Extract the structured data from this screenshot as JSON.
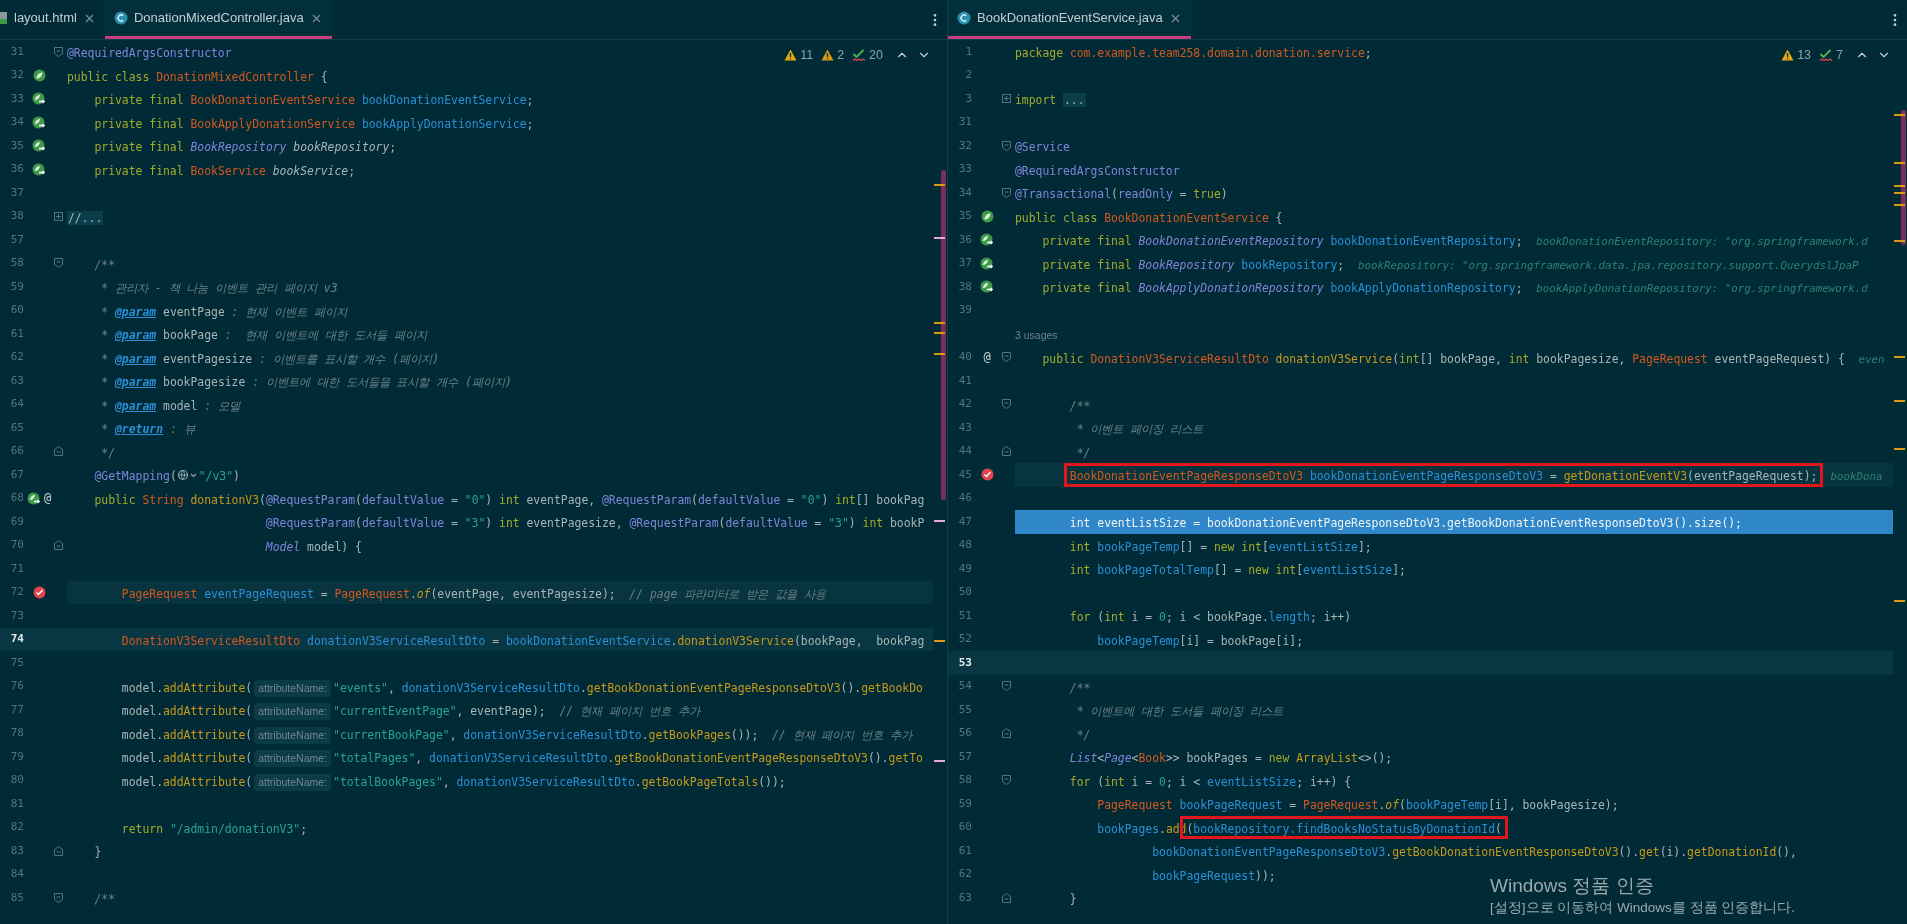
{
  "panes": [
    {
      "tabs": [
        {
          "label": "layout.html",
          "kind": "html",
          "selected": false
        },
        {
          "label": "DonationMixedController.java",
          "kind": "class",
          "selected": true
        }
      ],
      "inspections": [
        {
          "kind": "warning",
          "count": "11"
        },
        {
          "kind": "weak_warning",
          "count": "2"
        },
        {
          "kind": "typo",
          "count": "20"
        }
      ],
      "lines": [
        {
          "number": "31",
          "fold": {
            "kind": "start"
          },
          "tokens": [
            {
              "kind": "annotation",
              "text": "@RequiredArgsConstructor"
            }
          ]
        },
        {
          "number": "32",
          "gutter": [
            {
              "kind": "bean"
            }
          ],
          "tokens": [
            {
              "kind": "keyword",
              "text": "public class "
            },
            {
              "kind": "type",
              "text": "DonationMixedController"
            },
            {
              "kind": "plain",
              "text": " {"
            }
          ]
        },
        {
          "number": "33",
          "gutter": [
            {
              "kind": "bean_injected"
            }
          ],
          "tokens": [
            {
              "kind": "keyword",
              "text": "    private final "
            },
            {
              "kind": "type",
              "text": "BookDonationEventService "
            },
            {
              "kind": "field",
              "text": "bookDonationEventService"
            },
            {
              "kind": "plain",
              "text": ";"
            }
          ]
        },
        {
          "number": "34",
          "gutter": [
            {
              "kind": "bean_injected"
            }
          ],
          "tokens": [
            {
              "kind": "keyword",
              "text": "    private final "
            },
            {
              "kind": "type",
              "text": "BookApplyDonationService "
            },
            {
              "kind": "field",
              "text": "bookApplyDonationService"
            },
            {
              "kind": "plain",
              "text": ";"
            }
          ]
        },
        {
          "number": "35",
          "gutter": [
            {
              "kind": "bean_injected"
            }
          ],
          "tokens": [
            {
              "kind": "keyword",
              "text": "    private final "
            },
            {
              "kind": "interface",
              "text": "BookRepository "
            },
            {
              "kind": "field_italic",
              "text": "bookRepository"
            },
            {
              "kind": "plain",
              "text": ";"
            }
          ]
        },
        {
          "number": "36",
          "gutter": [
            {
              "kind": "bean_injected"
            }
          ],
          "tokens": [
            {
              "kind": "keyword",
              "text": "    private final "
            },
            {
              "kind": "type",
              "text": "BookService "
            },
            {
              "kind": "field_italic",
              "text": "bookService"
            },
            {
              "kind": "plain",
              "text": ";"
            }
          ]
        },
        {
          "number": "37"
        },
        {
          "number": "38",
          "fold": {
            "kind": "collapsed"
          },
          "tokens": [
            {
              "kind": "folded",
              "text": "//..."
            }
          ]
        },
        {
          "number": "57"
        },
        {
          "number": "58",
          "fold": {
            "kind": "start"
          },
          "tokens": [
            {
              "kind": "comment",
              "text": "    /**"
            }
          ]
        },
        {
          "number": "59",
          "tokens": [
            {
              "kind": "comment",
              "text": "     * 관리자 - 책 나눔 이벤트 관리 페이지 v3"
            }
          ]
        },
        {
          "number": "60",
          "tokens": [
            {
              "kind": "comment",
              "text": "     * "
            },
            {
              "kind": "doc_tag",
              "text": "@param"
            },
            {
              "kind": "doc_word",
              "text": " eventPage"
            },
            {
              "kind": "comment",
              "text": " : 현재 이벤트 페이지"
            }
          ]
        },
        {
          "number": "61",
          "tokens": [
            {
              "kind": "comment",
              "text": "     * "
            },
            {
              "kind": "doc_tag",
              "text": "@param"
            },
            {
              "kind": "doc_word",
              "text": " bookPage"
            },
            {
              "kind": "comment",
              "text": " :  현재 이벤트에 대한 도서들 페이지"
            }
          ]
        },
        {
          "number": "62",
          "tokens": [
            {
              "kind": "comment",
              "text": "     * "
            },
            {
              "kind": "doc_tag",
              "text": "@param"
            },
            {
              "kind": "doc_word",
              "text": " eventPagesize"
            },
            {
              "kind": "comment",
              "text": " : 이벤트를 표시할 개수 (페이지)"
            }
          ]
        },
        {
          "number": "63",
          "tokens": [
            {
              "kind": "comment",
              "text": "     * "
            },
            {
              "kind": "doc_tag",
              "text": "@param"
            },
            {
              "kind": "doc_word",
              "text": " bookPagesize"
            },
            {
              "kind": "comment",
              "text": " : 이벤트에 대한 도서들을 표시할 개수 (페이지)"
            }
          ]
        },
        {
          "number": "64",
          "tokens": [
            {
              "kind": "comment",
              "text": "     * "
            },
            {
              "kind": "doc_tag",
              "text": "@param"
            },
            {
              "kind": "doc_word",
              "text": " model"
            },
            {
              "kind": "comment",
              "text": " : 모델"
            }
          ]
        },
        {
          "number": "65",
          "tokens": [
            {
              "kind": "comment",
              "text": "     * "
            },
            {
              "kind": "doc_tag",
              "text": "@return"
            },
            {
              "kind": "comment",
              "text": " : 뷰"
            }
          ]
        },
        {
          "number": "66",
          "fold": {
            "kind": "end"
          },
          "tokens": [
            {
              "kind": "comment",
              "text": "     */"
            }
          ]
        },
        {
          "number": "67",
          "tokens": [
            {
              "kind": "annotation",
              "text": "    @GetMapping"
            },
            {
              "kind": "plain",
              "text": "("
            },
            {
              "kind": "globe"
            },
            {
              "kind": "string",
              "text": "\"/v3\""
            },
            {
              "kind": "plain",
              "text": ")"
            }
          ]
        },
        {
          "number": "68",
          "gutter": [
            {
              "kind": "bean_injected"
            },
            {
              "kind": "at",
              "text": "@"
            }
          ],
          "tokens": [
            {
              "kind": "keyword",
              "text": "    public "
            },
            {
              "kind": "type",
              "text": "String "
            },
            {
              "kind": "method",
              "text": "donationV3"
            },
            {
              "kind": "plain",
              "text": "("
            },
            {
              "kind": "annotation",
              "text": "@RequestParam"
            },
            {
              "kind": "plain",
              "text": "("
            },
            {
              "kind": "annotation",
              "text": "defaultValue"
            },
            {
              "kind": "plain",
              "text": " = "
            },
            {
              "kind": "string",
              "text": "\"0\""
            },
            {
              "kind": "plain",
              "text": ") "
            },
            {
              "kind": "keyword",
              "text": "int "
            },
            {
              "kind": "plain",
              "text": "eventPage, "
            },
            {
              "kind": "annotation",
              "text": "@RequestParam"
            },
            {
              "kind": "plain",
              "text": "("
            },
            {
              "kind": "annotation",
              "text": "defaultValue"
            },
            {
              "kind": "plain",
              "text": " = "
            },
            {
              "kind": "string",
              "text": "\"0\""
            },
            {
              "kind": "plain",
              "text": ") "
            },
            {
              "kind": "keyword",
              "text": "int"
            },
            {
              "kind": "plain",
              "text": "[] bookPag"
            }
          ]
        },
        {
          "number": "69",
          "tokens": [
            {
              "kind": "annotation",
              "text": "                             @RequestParam"
            },
            {
              "kind": "plain",
              "text": "("
            },
            {
              "kind": "annotation",
              "text": "defaultValue"
            },
            {
              "kind": "plain",
              "text": " = "
            },
            {
              "kind": "string",
              "text": "\"3\""
            },
            {
              "kind": "plain",
              "text": ") "
            },
            {
              "kind": "keyword",
              "text": "int "
            },
            {
              "kind": "plain",
              "text": "eventPagesize, "
            },
            {
              "kind": "annotation",
              "text": "@RequestParam"
            },
            {
              "kind": "plain",
              "text": "("
            },
            {
              "kind": "annotation",
              "text": "defaultValue"
            },
            {
              "kind": "plain",
              "text": " = "
            },
            {
              "kind": "string",
              "text": "\"3\""
            },
            {
              "kind": "plain",
              "text": ") "
            },
            {
              "kind": "keyword",
              "text": "int "
            },
            {
              "kind": "plain",
              "text": "bookP"
            }
          ]
        },
        {
          "number": "70",
          "fold": {
            "kind": "end"
          },
          "tokens": [
            {
              "kind": "interface",
              "text": "                             Model"
            },
            {
              "kind": "plain",
              "text": " model) {"
            }
          ]
        },
        {
          "number": "71"
        },
        {
          "number": "72",
          "highlight": {
            "kind": "execution"
          },
          "gutter": [
            {
              "kind": "breakpoint"
            }
          ],
          "tokens": [
            {
              "kind": "type",
              "text": "        PageRequest "
            },
            {
              "kind": "field",
              "text": "eventPageRequest"
            },
            {
              "kind": "plain",
              "text": " = "
            },
            {
              "kind": "type",
              "text": "PageRequest"
            },
            {
              "kind": "plain",
              "text": "."
            },
            {
              "kind": "static_method",
              "text": "of"
            },
            {
              "kind": "plain",
              "text": "(eventPage, eventPagesize);  "
            },
            {
              "kind": "comment",
              "text": "// page 파라미터로 받은 값을 사용"
            }
          ]
        },
        {
          "number": "73"
        },
        {
          "number": "74",
          "highlight": {
            "kind": "caret"
          },
          "tokens": [
            {
              "kind": "type",
              "text": "        DonationV3ServiceResultDto "
            },
            {
              "kind": "field",
              "text": "donationV3ServiceResultDto"
            },
            {
              "kind": "plain",
              "text": " = "
            },
            {
              "kind": "field",
              "text": "bookDonationEventService"
            },
            {
              "kind": "plain",
              "text": "."
            },
            {
              "kind": "method",
              "text": "donationV3Service"
            },
            {
              "kind": "plain",
              "text": "(bookPage,  bookPag"
            }
          ]
        },
        {
          "number": "75"
        },
        {
          "number": "76",
          "tokens": [
            {
              "kind": "plain",
              "text": "        model."
            },
            {
              "kind": "method",
              "text": "addAttribute"
            },
            {
              "kind": "plain",
              "text": "("
            },
            {
              "kind": "hint",
              "text": "attributeName:"
            },
            {
              "kind": "string",
              "text": "\"events\""
            },
            {
              "kind": "plain",
              "text": ", "
            },
            {
              "kind": "field",
              "text": "donationV3ServiceResultDto"
            },
            {
              "kind": "plain",
              "text": "."
            },
            {
              "kind": "method",
              "text": "getBookDonationEventPageResponseDtoV3"
            },
            {
              "kind": "plain",
              "text": "()."
            },
            {
              "kind": "method",
              "text": "getBookDo"
            }
          ]
        },
        {
          "number": "77",
          "tokens": [
            {
              "kind": "plain",
              "text": "        model."
            },
            {
              "kind": "method",
              "text": "addAttribute"
            },
            {
              "kind": "plain",
              "text": "("
            },
            {
              "kind": "hint",
              "text": "attributeName:"
            },
            {
              "kind": "string",
              "text": "\"currentEventPage\""
            },
            {
              "kind": "plain",
              "text": ", eventPage);  "
            },
            {
              "kind": "comment",
              "text": "// 현재 페이지 번호 추가"
            }
          ]
        },
        {
          "number": "78",
          "tokens": [
            {
              "kind": "plain",
              "text": "        model."
            },
            {
              "kind": "method",
              "text": "addAttribute"
            },
            {
              "kind": "plain",
              "text": "("
            },
            {
              "kind": "hint",
              "text": "attributeName:"
            },
            {
              "kind": "string",
              "text": "\"currentBookPage\""
            },
            {
              "kind": "plain",
              "text": ", "
            },
            {
              "kind": "field",
              "text": "donationV3ServiceResultDto"
            },
            {
              "kind": "plain",
              "text": "."
            },
            {
              "kind": "method",
              "text": "getBookPages"
            },
            {
              "kind": "plain",
              "text": "());  "
            },
            {
              "kind": "comment",
              "text": "// 현재 페이지 번호 추가"
            }
          ]
        },
        {
          "number": "79",
          "tokens": [
            {
              "kind": "plain",
              "text": "        model."
            },
            {
              "kind": "method",
              "text": "addAttribute"
            },
            {
              "kind": "plain",
              "text": "("
            },
            {
              "kind": "hint",
              "text": "attributeName:"
            },
            {
              "kind": "string",
              "text": "\"totalPages\""
            },
            {
              "kind": "plain",
              "text": ", "
            },
            {
              "kind": "field",
              "text": "donationV3ServiceResultDto"
            },
            {
              "kind": "plain",
              "text": "."
            },
            {
              "kind": "method",
              "text": "getBookDonationEventPageResponseDtoV3"
            },
            {
              "kind": "plain",
              "text": "()."
            },
            {
              "kind": "method",
              "text": "getTo"
            }
          ]
        },
        {
          "number": "80",
          "tokens": [
            {
              "kind": "plain",
              "text": "        model."
            },
            {
              "kind": "method",
              "text": "addAttribute"
            },
            {
              "kind": "plain",
              "text": "("
            },
            {
              "kind": "hint",
              "text": "attributeName:"
            },
            {
              "kind": "string",
              "text": "\"totalBookPages\""
            },
            {
              "kind": "plain",
              "text": ", "
            },
            {
              "kind": "field",
              "text": "donationV3ServiceResultDto"
            },
            {
              "kind": "plain",
              "text": "."
            },
            {
              "kind": "method",
              "text": "getBookPageTotals"
            },
            {
              "kind": "plain",
              "text": "());"
            }
          ]
        },
        {
          "number": "81"
        },
        {
          "number": "82",
          "tokens": [
            {
              "kind": "keyword",
              "text": "        return "
            },
            {
              "kind": "string",
              "text": "\"/admin/donationV3\""
            },
            {
              "kind": "plain",
              "text": ";"
            }
          ]
        },
        {
          "number": "83",
          "fold": {
            "kind": "end"
          },
          "tokens": [
            {
              "kind": "plain",
              "text": "    }"
            }
          ]
        },
        {
          "number": "84"
        },
        {
          "number": "85",
          "fold": {
            "kind": "start"
          },
          "tokens": [
            {
              "kind": "comment",
              "text": "    /**"
            }
          ]
        }
      ]
    },
    {
      "tabs": [
        {
          "label": "BookDonationEventService.java",
          "kind": "class",
          "selected": true
        }
      ],
      "inspections": [
        {
          "kind": "warning",
          "count": "13"
        },
        {
          "kind": "typo",
          "count": "7"
        }
      ],
      "lines": [
        {
          "number": "1",
          "tokens": [
            {
              "kind": "keyword",
              "text": "package "
            },
            {
              "kind": "type",
              "text": "com.example.team258.domain.donation.service"
            },
            {
              "kind": "plain",
              "text": ";"
            }
          ]
        },
        {
          "number": "2"
        },
        {
          "number": "3",
          "fold": {
            "kind": "collapsed"
          },
          "tokens": [
            {
              "kind": "keyword",
              "text": "import "
            },
            {
              "kind": "folded",
              "text": "..."
            }
          ]
        },
        {
          "number": "31"
        },
        {
          "number": "32",
          "fold": {
            "kind": "start"
          },
          "tokens": [
            {
              "kind": "annotation",
              "text": "@Service"
            }
          ]
        },
        {
          "number": "33",
          "tokens": [
            {
              "kind": "annotation",
              "text": "@RequiredArgsConstructor"
            }
          ]
        },
        {
          "number": "34",
          "fold": {
            "kind": "start"
          },
          "tokens": [
            {
              "kind": "annotation",
              "text": "@Transactional"
            },
            {
              "kind": "plain",
              "text": "("
            },
            {
              "kind": "annotation",
              "text": "readOnly"
            },
            {
              "kind": "plain",
              "text": " = "
            },
            {
              "kind": "keyword",
              "text": "true"
            },
            {
              "kind": "plain",
              "text": ")"
            }
          ]
        },
        {
          "number": "35",
          "gutter": [
            {
              "kind": "bean"
            }
          ],
          "tokens": [
            {
              "kind": "keyword",
              "text": "public class "
            },
            {
              "kind": "type",
              "text": "BookDonationEventService"
            },
            {
              "kind": "plain",
              "text": " {"
            }
          ]
        },
        {
          "number": "36",
          "gutter": [
            {
              "kind": "bean_injected"
            }
          ],
          "tokens": [
            {
              "kind": "keyword",
              "text": "    private final "
            },
            {
              "kind": "interface",
              "text": "BookDonationEventRepository "
            },
            {
              "kind": "field",
              "text": "bookDonationEventRepository"
            },
            {
              "kind": "plain",
              "text": ";  "
            },
            {
              "kind": "value_hint",
              "text": "bookDonationEventRepository: \"org.springframework.d"
            }
          ]
        },
        {
          "number": "37",
          "gutter": [
            {
              "kind": "bean_injected"
            }
          ],
          "tokens": [
            {
              "kind": "keyword",
              "text": "    private final "
            },
            {
              "kind": "interface",
              "text": "BookRepository "
            },
            {
              "kind": "field",
              "text": "bookRepository"
            },
            {
              "kind": "plain",
              "text": ";  "
            },
            {
              "kind": "value_hint",
              "text": "bookRepository: \"org.springframework.data.jpa.repository.support.QuerydslJpaP"
            }
          ]
        },
        {
          "number": "38",
          "gutter": [
            {
              "kind": "bean_injected"
            }
          ],
          "tokens": [
            {
              "kind": "keyword",
              "text": "    private final "
            },
            {
              "kind": "interface",
              "text": "BookApplyDonationRepository "
            },
            {
              "kind": "field",
              "text": "bookApplyDonationRepository"
            },
            {
              "kind": "plain",
              "text": ";  "
            },
            {
              "kind": "value_hint",
              "text": "bookApplyDonationRepository: \"org.springframework.d"
            }
          ]
        },
        {
          "number": "39"
        },
        {
          "tokens": [
            {
              "kind": "usages",
              "text": "3 usages"
            }
          ]
        },
        {
          "number": "40",
          "fold": {
            "kind": "start"
          },
          "gutter": [
            {
              "kind": "at",
              "text": "@"
            }
          ],
          "tokens": [
            {
              "kind": "keyword",
              "text": "    public "
            },
            {
              "kind": "type",
              "text": "DonationV3ServiceResultDto "
            },
            {
              "kind": "method",
              "text": "donationV3Service"
            },
            {
              "kind": "plain",
              "text": "("
            },
            {
              "kind": "keyword",
              "text": "int"
            },
            {
              "kind": "plain",
              "text": "[] bookPage, "
            },
            {
              "kind": "keyword",
              "text": "int "
            },
            {
              "kind": "plain",
              "text": "bookPagesize, "
            },
            {
              "kind": "type",
              "text": "PageRequest "
            },
            {
              "kind": "plain",
              "text": "eventPageRequest) {  "
            },
            {
              "kind": "value_hint",
              "text": "even"
            }
          ]
        },
        {
          "number": "41"
        },
        {
          "number": "42",
          "fold": {
            "kind": "start"
          },
          "tokens": [
            {
              "kind": "comment",
              "text": "        /**"
            }
          ]
        },
        {
          "number": "43",
          "tokens": [
            {
              "kind": "comment",
              "text": "         * 이벤트 페이징 리스트"
            }
          ]
        },
        {
          "number": "44",
          "fold": {
            "kind": "end"
          },
          "tokens": [
            {
              "kind": "comment",
              "text": "         */"
            }
          ]
        },
        {
          "number": "45",
          "highlight": {
            "kind": "execution"
          },
          "gutter": [
            {
              "kind": "breakpoint"
            }
          ],
          "tokens": [
            {
              "kind": "box",
              "children": [
                {
                  "kind": "type",
                  "text": "        BookDonationEventPageResponseDtoV3 "
                },
                {
                  "kind": "field",
                  "text": "bookDonationEventPageResponseDtoV3"
                },
                {
                  "kind": "plain",
                  "text": " = "
                },
                {
                  "kind": "method",
                  "text": "getDonationEventV3"
                },
                {
                  "kind": "plain",
                  "text": "(eventPageRequest);"
                }
              ]
            },
            {
              "kind": "value_hint",
              "text": "  bookDona"
            }
          ]
        },
        {
          "number": "46"
        },
        {
          "number": "47",
          "highlight": {
            "kind": "selected"
          },
          "tokens": [
            {
              "kind": "keyword",
              "text": "        int "
            },
            {
              "kind": "plain",
              "text": "eventListSize = "
            },
            {
              "kind": "field",
              "text": "bookDonationEventPageResponseDtoV3"
            },
            {
              "kind": "plain",
              "text": "."
            },
            {
              "kind": "method",
              "text": "getBookDonationEventResponseDtoV3"
            },
            {
              "kind": "plain",
              "text": "()."
            },
            {
              "kind": "method",
              "text": "size"
            },
            {
              "kind": "plain",
              "text": "();"
            }
          ]
        },
        {
          "number": "48",
          "tokens": [
            {
              "kind": "keyword",
              "text": "        int "
            },
            {
              "kind": "field",
              "text": "bookPageTemp"
            },
            {
              "kind": "plain",
              "text": "[] = "
            },
            {
              "kind": "keyword",
              "text": "new int"
            },
            {
              "kind": "plain",
              "text": "["
            },
            {
              "kind": "field",
              "text": "eventListSize"
            },
            {
              "kind": "plain",
              "text": "];"
            }
          ]
        },
        {
          "number": "49",
          "tokens": [
            {
              "kind": "keyword",
              "text": "        int "
            },
            {
              "kind": "field",
              "text": "bookPageTotalTemp"
            },
            {
              "kind": "plain",
              "text": "[] = "
            },
            {
              "kind": "keyword",
              "text": "new int"
            },
            {
              "kind": "plain",
              "text": "["
            },
            {
              "kind": "field",
              "text": "eventListSize"
            },
            {
              "kind": "plain",
              "text": "];"
            }
          ]
        },
        {
          "number": "50"
        },
        {
          "number": "51",
          "tokens": [
            {
              "kind": "keyword",
              "text": "        for "
            },
            {
              "kind": "plain",
              "text": "("
            },
            {
              "kind": "keyword",
              "text": "int "
            },
            {
              "kind": "plain",
              "text": "i = "
            },
            {
              "kind": "number",
              "text": "0"
            },
            {
              "kind": "plain",
              "text": "; i < bookPage."
            },
            {
              "kind": "field",
              "text": "length"
            },
            {
              "kind": "plain",
              "text": "; i++)"
            }
          ]
        },
        {
          "number": "52",
          "tokens": [
            {
              "kind": "field",
              "text": "            bookPageTemp"
            },
            {
              "kind": "plain",
              "text": "[i] = bookPage[i];"
            }
          ]
        },
        {
          "number": "53",
          "highlight": {
            "kind": "caret"
          }
        },
        {
          "number": "54",
          "fold": {
            "kind": "start"
          },
          "tokens": [
            {
              "kind": "comment",
              "text": "        /**"
            }
          ]
        },
        {
          "number": "55",
          "tokens": [
            {
              "kind": "comment",
              "text": "         * 이벤트에 대한 도서들 페이징 리스트"
            }
          ]
        },
        {
          "number": "56",
          "fold": {
            "kind": "end"
          },
          "tokens": [
            {
              "kind": "comment",
              "text": "         */"
            }
          ]
        },
        {
          "number": "57",
          "tokens": [
            {
              "kind": "interface",
              "text": "        List"
            },
            {
              "kind": "plain",
              "text": "<"
            },
            {
              "kind": "interface",
              "text": "Page"
            },
            {
              "kind": "plain",
              "text": "<"
            },
            {
              "kind": "type",
              "text": "Book"
            },
            {
              "kind": "plain",
              "text": ">> bookPages = "
            },
            {
              "kind": "keyword",
              "text": "new "
            },
            {
              "kind": "method",
              "text": "ArrayList"
            },
            {
              "kind": "plain",
              "text": "<>();"
            }
          ]
        },
        {
          "number": "58",
          "fold": {
            "kind": "start"
          },
          "tokens": [
            {
              "kind": "keyword",
              "text": "        for "
            },
            {
              "kind": "plain",
              "text": "("
            },
            {
              "kind": "keyword",
              "text": "int "
            },
            {
              "kind": "plain",
              "text": "i = "
            },
            {
              "kind": "number",
              "text": "0"
            },
            {
              "kind": "plain",
              "text": "; i < "
            },
            {
              "kind": "field",
              "text": "eventListSize"
            },
            {
              "kind": "plain",
              "text": "; i++) {"
            }
          ]
        },
        {
          "number": "59",
          "tokens": [
            {
              "kind": "type",
              "text": "            PageRequest "
            },
            {
              "kind": "field",
              "text": "bookPageRequest"
            },
            {
              "kind": "plain",
              "text": " = "
            },
            {
              "kind": "type",
              "text": "PageRequest"
            },
            {
              "kind": "plain",
              "text": "."
            },
            {
              "kind": "static_method",
              "text": "of"
            },
            {
              "kind": "plain",
              "text": "("
            },
            {
              "kind": "field",
              "text": "bookPageTemp"
            },
            {
              "kind": "plain",
              "text": "[i], bookPagesize);"
            }
          ]
        },
        {
          "number": "60",
          "tokens": [
            {
              "kind": "field",
              "text": "            bookPages"
            },
            {
              "kind": "plain",
              "text": "."
            },
            {
              "kind": "method",
              "text": "add"
            },
            {
              "kind": "box",
              "children": [
                {
                  "kind": "plain",
                  "text": "("
                },
                {
                  "kind": "field",
                  "text": "bookRepository.findBooksNoStatusByDonationId"
                },
                {
                  "kind": "plain",
                  "text": "("
                }
              ]
            }
          ]
        },
        {
          "number": "61",
          "tokens": [
            {
              "kind": "field",
              "text": "                    bookDonationEventPageResponseDtoV3"
            },
            {
              "kind": "plain",
              "text": "."
            },
            {
              "kind": "method",
              "text": "getBookDonationEventResponseDtoV3"
            },
            {
              "kind": "plain",
              "text": "()."
            },
            {
              "kind": "method",
              "text": "get"
            },
            {
              "kind": "plain",
              "text": "(i)."
            },
            {
              "kind": "method",
              "text": "getDonationId"
            },
            {
              "kind": "plain",
              "text": "(),"
            }
          ]
        },
        {
          "number": "62",
          "tokens": [
            {
              "kind": "field",
              "text": "                    bookPageRequest"
            },
            {
              "kind": "plain",
              "text": "));"
            }
          ]
        },
        {
          "number": "63",
          "fold": {
            "kind": "end"
          },
          "tokens": [
            {
              "kind": "plain",
              "text": "        }"
            }
          ]
        }
      ]
    }
  ],
  "activation_notice": {
    "title": "Windows 정품 인증",
    "message": "[설정]으로 이동하여 Windows를 정품 인증합니다."
  }
}
